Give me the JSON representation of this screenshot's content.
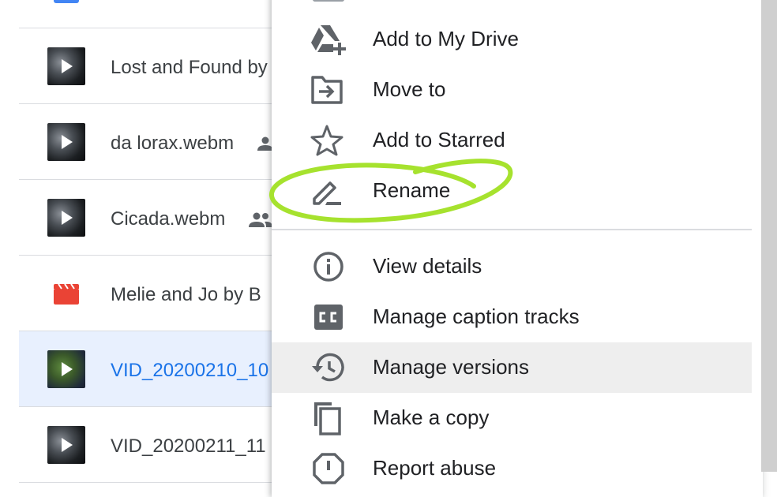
{
  "files": [
    {
      "name": "Lost and Found by",
      "thumbnail": "video",
      "shared": false,
      "selected": false
    },
    {
      "name": "da lorax.webm",
      "thumbnail": "video",
      "shared": true,
      "selected": false
    },
    {
      "name": "Cicada.webm",
      "thumbnail": "video",
      "shared": true,
      "selected": false
    },
    {
      "name": "Melie and Jo by B",
      "thumbnail": "clapper",
      "shared": false,
      "selected": false
    },
    {
      "name": "VID_20200210_10",
      "thumbnail": "video",
      "shared": false,
      "selected": true
    },
    {
      "name": "VID_20200211_11",
      "thumbnail": "video",
      "shared": false,
      "selected": false
    }
  ],
  "menu": {
    "items": [
      {
        "label": "Add to My Drive",
        "icon": "drive-add-icon"
      },
      {
        "label": "Move to",
        "icon": "folder-move-icon"
      },
      {
        "label": "Add to Starred",
        "icon": "star-icon"
      },
      {
        "label": "Rename",
        "icon": "pencil-icon"
      },
      {
        "label": "View details",
        "icon": "info-icon"
      },
      {
        "label": "Manage caption tracks",
        "icon": "cc-icon"
      },
      {
        "label": "Manage versions",
        "icon": "history-icon",
        "highlighted": true
      },
      {
        "label": "Make a copy",
        "icon": "copy-icon"
      },
      {
        "label": "Report abuse",
        "icon": "report-icon"
      }
    ]
  },
  "colors": {
    "selected_row_bg": "#e8f0fe",
    "selected_text": "#1a73e8",
    "highlight_bg": "#eeeeee",
    "annotation": "#a6e22e"
  }
}
